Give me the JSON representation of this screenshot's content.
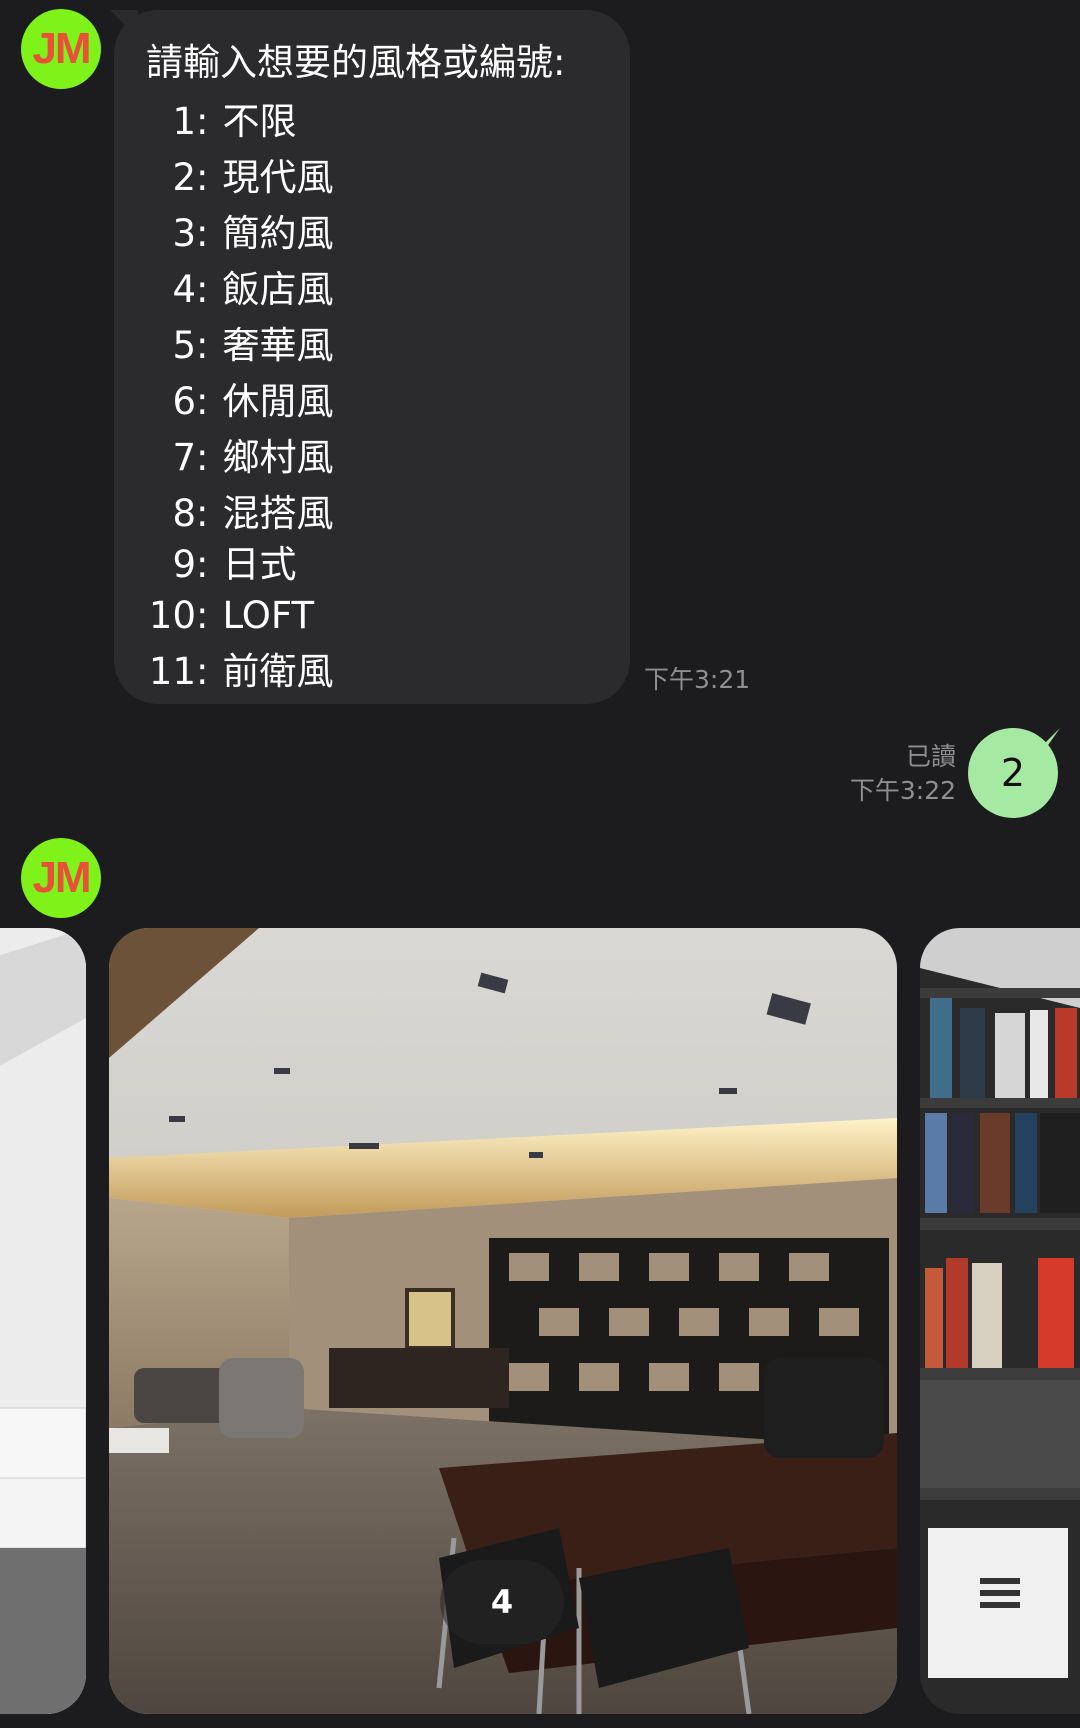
{
  "messages": {
    "bot_avatar_text": "JM",
    "prompt": "請輸入想要的風格或編號:",
    "options": [
      {
        "num": "1",
        "label": "不限"
      },
      {
        "num": "2",
        "label": "現代風"
      },
      {
        "num": "3",
        "label": "簡約風"
      },
      {
        "num": "4",
        "label": "飯店風"
      },
      {
        "num": "5",
        "label": "奢華風"
      },
      {
        "num": "6",
        "label": "休閒風"
      },
      {
        "num": "7",
        "label": "鄉村風"
      },
      {
        "num": "8",
        "label": "混搭風"
      },
      {
        "num": "9",
        "label": "日式"
      },
      {
        "num": "10",
        "label": "LOFT"
      },
      {
        "num": "11",
        "label": "前衛風"
      }
    ],
    "incoming_time": "下午3:21",
    "outgoing_read": "已讀",
    "outgoing_time": "下午3:22",
    "outgoing_text": "2",
    "carousel_counter": "4"
  },
  "colors": {
    "background": "#1c1c1e",
    "incoming_bubble": "#2b2b2d",
    "outgoing_bubble": "#a6e9a2",
    "avatar_bg": "#7ff21a",
    "avatar_text": "#e8503a"
  }
}
